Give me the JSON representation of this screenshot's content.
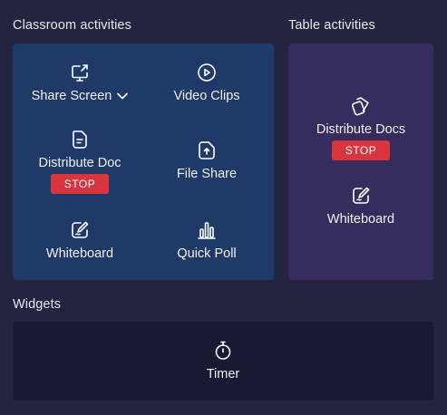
{
  "sections": {
    "classroom_title": "Classroom activities",
    "table_title": "Table activities",
    "widgets_title": "Widgets"
  },
  "classroom": {
    "share_screen": "Share Screen",
    "video_clips": "Video Clips",
    "distribute_doc": "Distribute Doc",
    "distribute_doc_stop": "STOP",
    "file_share": "File Share",
    "whiteboard": "Whiteboard",
    "quick_poll": "Quick Poll"
  },
  "table": {
    "distribute_docs": "Distribute Docs",
    "distribute_docs_stop": "STOP",
    "whiteboard": "Whiteboard"
  },
  "widgets": {
    "timer": "Timer"
  },
  "colors": {
    "background": "#232440",
    "classroom_panel": "#1f3a69",
    "table_panel": "#362d5e",
    "widgets_panel": "#181a33",
    "stop": "#d9353f"
  }
}
